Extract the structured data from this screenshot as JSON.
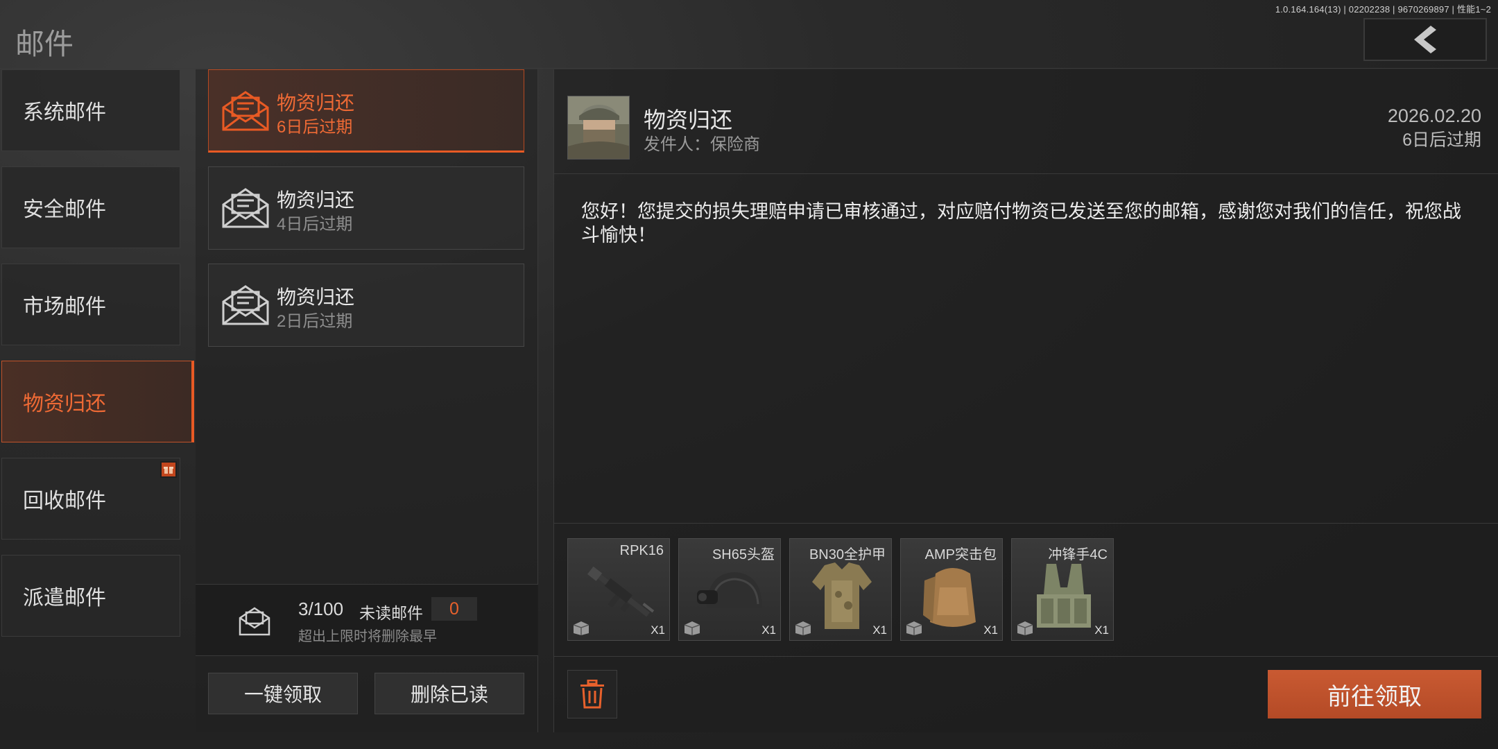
{
  "version": "1.0.164.164(13) | 02202238 | 9670269897 | 性能1~2",
  "page_title": "邮件",
  "categories": [
    {
      "label": "系统邮件"
    },
    {
      "label": "安全邮件"
    },
    {
      "label": "市场邮件"
    },
    {
      "label": "物资归还",
      "active": true
    },
    {
      "label": "回收邮件",
      "badge": "gift-icon"
    },
    {
      "label": "派遣邮件"
    }
  ],
  "mails": [
    {
      "title": "物资归还",
      "expire": "6日后过期",
      "active": true
    },
    {
      "title": "物资归还",
      "expire": "4日后过期"
    },
    {
      "title": "物资归还",
      "expire": "2日后过期"
    }
  ],
  "mailbox": {
    "count": "3/100",
    "unread_label": "未读邮件",
    "unread_count": "0",
    "note": "超出上限时将删除最早"
  },
  "actions": {
    "claim_all": "一键领取",
    "delete_read": "删除已读"
  },
  "detail": {
    "title": "物资归还",
    "sender_label": "发件人：",
    "sender": "保险商",
    "date": "2026.02.20",
    "expire": "6日后过期",
    "body": "您好！您提交的损失理赔申请已审核通过，对应赔付物资已发送至您的邮箱，感谢您对我们的信任，祝您战斗愉快！",
    "attachments": [
      {
        "name": "RPK16",
        "qty": "X1",
        "icon": "rifle-icon"
      },
      {
        "name": "SH65头盔",
        "qty": "X1",
        "icon": "helmet-icon"
      },
      {
        "name": "BN30全护甲",
        "qty": "X1",
        "icon": "body-armor-icon"
      },
      {
        "name": "AMP突击包",
        "qty": "X1",
        "icon": "backpack-icon"
      },
      {
        "name": "冲锋手4C",
        "qty": "X1",
        "icon": "chest-rig-icon"
      }
    ],
    "claim_button": "前往领取"
  },
  "colors": {
    "accent": "#e85a24",
    "claim_bg": "#c05530"
  }
}
